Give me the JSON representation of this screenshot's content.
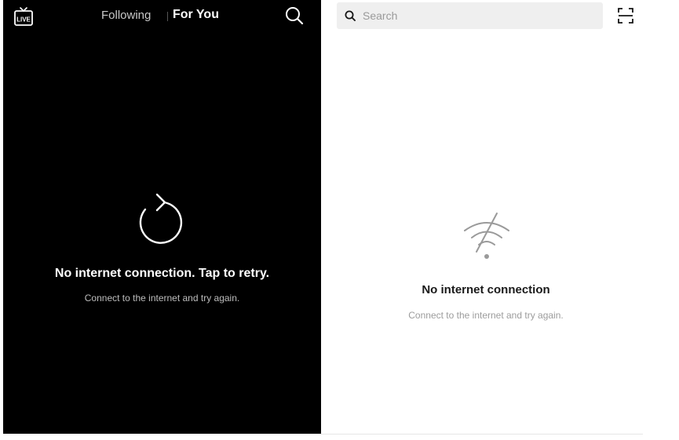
{
  "feed": {
    "live_badge": "LIVE",
    "tabs": [
      {
        "label": "Following",
        "active": false
      },
      {
        "label": "For You",
        "active": true
      }
    ],
    "icons": {
      "live": "live-tv-icon",
      "search": "search-icon",
      "retry": "refresh-icon"
    },
    "error_title": "No internet connection. Tap to retry.",
    "error_subtitle": "Connect to the internet and try again."
  },
  "discover": {
    "search": {
      "placeholder": "Search",
      "value": ""
    },
    "icons": {
      "search": "search-icon",
      "scan": "scan-qr-icon",
      "no_wifi": "no-wifi-icon"
    },
    "error_title": "No internet connection",
    "error_subtitle": "Connect to the internet and try again."
  },
  "colors": {
    "feed_background": "#000000",
    "feed_active_tab": "#ffffff",
    "feed_inactive_tab": "#c9c9c9",
    "discover_background": "#ffffff",
    "search_background": "#efefef"
  }
}
